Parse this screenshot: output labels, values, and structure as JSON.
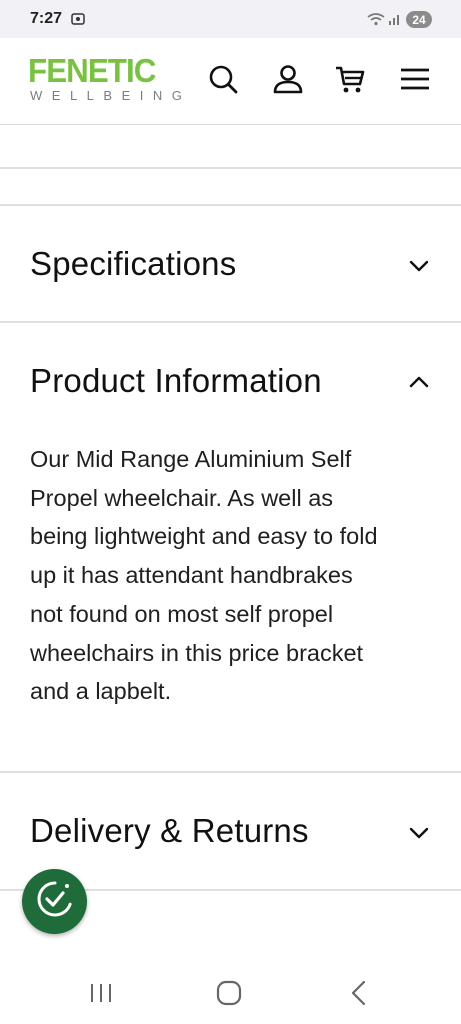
{
  "status_bar": {
    "time": "7:27",
    "battery": "24"
  },
  "brand": {
    "name": "FENETIC",
    "tagline": "WELLBEING",
    "color": "#7ac143"
  },
  "header_icons": [
    "search-icon",
    "account-icon",
    "cart-icon",
    "menu-icon"
  ],
  "accordion": {
    "specifications": {
      "title": "Specifications",
      "state": "collapsed"
    },
    "product_information": {
      "title": "Product Information",
      "state": "expanded",
      "body_lines": [
        "Our Mid Range Aluminium Self",
        "Propel wheelchair. As well as",
        "being lightweight and easy to fold",
        "up it has attendant handbrakes",
        "not found on most self propel",
        "wheelchairs in this price bracket",
        "and a lapbelt."
      ]
    },
    "delivery_returns": {
      "title": "Delivery & Returns",
      "state": "collapsed"
    }
  },
  "accessibility_button": {
    "icon": "accessibility-check-icon",
    "color": "#1f6b3a"
  },
  "system_nav": [
    "recent-apps-icon",
    "home-icon",
    "back-icon"
  ]
}
